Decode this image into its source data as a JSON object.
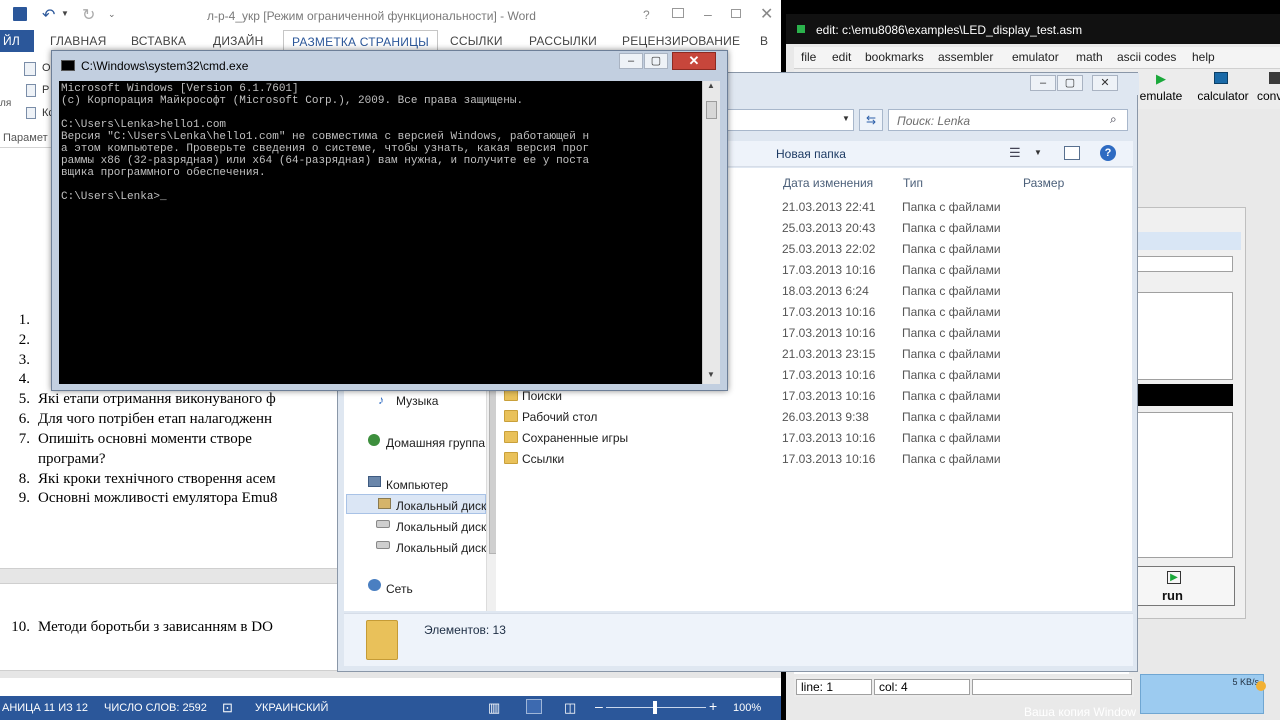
{
  "word": {
    "title": "л-р-4_укр [Режим ограниченной функциональности] - Word",
    "ribbon_tabs": [
      "ЙЛ",
      "ГЛАВНАЯ",
      "ВСТАВКА",
      "ДИЗАЙН",
      "РАЗМЕТКА СТРАНИЦЫ",
      "ССЫЛКИ",
      "РАССЫЛКИ",
      "РЕЦЕНЗИРОВАНИЕ",
      "В"
    ],
    "ribbon_left": [
      "О",
      "Р",
      "Кс"
    ],
    "ribbon_left_label": "Парамет",
    "ribbon_left_small": "ля",
    "questions": [
      {
        "num": "1.",
        "text": ""
      },
      {
        "num": "2.",
        "text": ""
      },
      {
        "num": "3.",
        "text": ""
      },
      {
        "num": "4.",
        "text": ""
      },
      {
        "num": "5.",
        "text": "Які етапи отримання виконуваного ф"
      },
      {
        "num": "6.",
        "text": "Для чого потрібен етап налагодженн"
      },
      {
        "num": "7.",
        "text": "Опишіть  основні  моменти  створе"
      },
      {
        "num": "",
        "text": "програми?"
      },
      {
        "num": "8.",
        "text": "Які кроки технічного створення асем"
      },
      {
        "num": "9.",
        "text": "Основні можливості емулятора Emu8"
      }
    ],
    "question10": {
      "num": "10.",
      "text": "Методи боротьби з зависанням в DO"
    },
    "status": {
      "page": "АНИЦА 11 ИЗ 12",
      "words": "ЧИСЛО СЛОВ: 2592",
      "lang": "УКРАИНСКИЙ",
      "zoom": "100%"
    }
  },
  "emu": {
    "title": "edit: c:\\emu8086\\examples\\LED_display_test.asm",
    "menu": [
      "file",
      "edit",
      "bookmarks",
      "assembler",
      "emulator",
      "math",
      "ascii codes",
      "help"
    ],
    "tools": [
      "emulate",
      "calculator",
      "conv"
    ],
    "status_line": "line: 1",
    "status_col": "col: 4",
    "run_label": "run",
    "activation": "Ваша копия Window",
    "net_speed": "5 KB/s"
  },
  "explorer": {
    "search_placeholder": "Поиск: Lenka",
    "new_folder": "Новая папка",
    "columns": {
      "date": "Дата изменения",
      "type": "Тип",
      "size": "Размер"
    },
    "nav": {
      "music": "Музыка",
      "homegroup": "Домашняя группа",
      "computer": "Компьютер",
      "disk1": "Локальный диск",
      "disk2": "Локальный диск",
      "disk3": "Локальный диск",
      "network": "Сеть"
    },
    "rows": [
      {
        "name": "",
        "date": "21.03.2013 22:41",
        "type": "Папка с файлами"
      },
      {
        "name": "",
        "date": "25.03.2013 20:43",
        "type": "Папка с файлами"
      },
      {
        "name": "",
        "date": "25.03.2013 22:02",
        "type": "Папка с файлами"
      },
      {
        "name": "",
        "date": "17.03.2013 10:16",
        "type": "Папка с файлами"
      },
      {
        "name": "",
        "date": "18.03.2013 6:24",
        "type": "Папка с файлами"
      },
      {
        "name": "",
        "date": "17.03.2013 10:16",
        "type": "Папка с файлами"
      },
      {
        "name": "",
        "date": "17.03.2013 10:16",
        "type": "Папка с файлами"
      },
      {
        "name": "",
        "date": "21.03.2013 23:15",
        "type": "Папка с файлами"
      },
      {
        "name": "",
        "date": "17.03.2013 10:16",
        "type": "Папка с файлами"
      },
      {
        "name": "Поиски",
        "date": "17.03.2013 10:16",
        "type": "Папка с файлами"
      },
      {
        "name": "Рабочий стол",
        "date": "26.03.2013 9:38",
        "type": "Папка с файлами"
      },
      {
        "name": "Сохраненные игры",
        "date": "17.03.2013 10:16",
        "type": "Папка с файлами"
      },
      {
        "name": "Ссылки",
        "date": "17.03.2013 10:16",
        "type": "Папка с файлами"
      }
    ],
    "items_count": "Элементов: 13"
  },
  "cmd": {
    "title": "C:\\Windows\\system32\\cmd.exe",
    "lines": [
      "Microsoft Windows [Version 6.1.7601]",
      "(c) Корпорация Майкрософт (Microsoft Corp.), 2009. Все права защищены.",
      "",
      "C:\\Users\\Lenka>hello1.com",
      "Версия \"C:\\Users\\Lenka\\hello1.com\" не совместима с версией Windows, работающей н",
      "а этом компьютере. Проверьте сведения о системе, чтобы узнать, какая версия прог",
      "раммы x86 (32-разрядная) или x64 (64-разрядная) вам нужна, и получите ее у поста",
      "вщика программного обеспечения.",
      "",
      "C:\\Users\\Lenka>_"
    ]
  }
}
